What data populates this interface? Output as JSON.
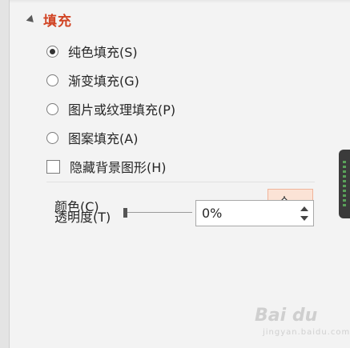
{
  "section": {
    "title": "填充"
  },
  "fill_options": [
    {
      "label": "纯色填充(S)",
      "checked": true
    },
    {
      "label": "渐变填充(G)",
      "checked": false
    },
    {
      "label": "图片或纹理填充(P)",
      "checked": false
    },
    {
      "label": "图案填充(A)",
      "checked": false
    }
  ],
  "hide_background": {
    "label": "隐藏背景图形(H)",
    "checked": false
  },
  "color": {
    "label": "颜色(C)",
    "icon": "paint-bucket-icon"
  },
  "transparency": {
    "label": "透明度(T)",
    "value": "0%",
    "slider_fraction": 0
  },
  "watermark": {
    "text": "Bai du",
    "sub": "jingyan.baidu.com"
  },
  "colors": {
    "accent": "#d14424",
    "color_button_bg": "#fbe3d6",
    "panel_bg": "#f3f3f3"
  }
}
